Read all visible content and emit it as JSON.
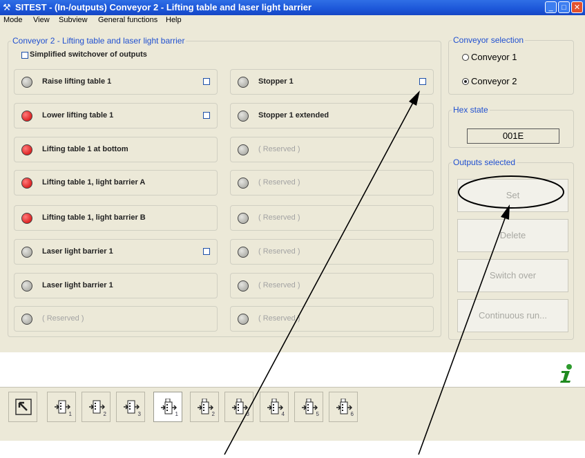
{
  "window": {
    "title": "SITEST - (In-/outputs) Conveyor 2 - Lifting table and laser light barrier",
    "minimize": "_",
    "maximize": "□",
    "close": "✕"
  },
  "menu": [
    "Mode",
    "View",
    "Subview",
    "General functions",
    "Help"
  ],
  "io_panel": {
    "legend": "Conveyor 2 - Lifting table and laser light barrier",
    "simplified_switchover": "Simplified switchover of outputs",
    "left": [
      {
        "label": "Raise lifting table 1",
        "led": "off",
        "checkbox": true
      },
      {
        "label": "Lower lifting table 1",
        "led": "on",
        "checkbox": true
      },
      {
        "label": "Lifting table 1 at bottom",
        "led": "on",
        "checkbox": false
      },
      {
        "label": "Lifting table 1, light barrier A",
        "led": "on",
        "checkbox": false
      },
      {
        "label": "Lifting table 1, light barrier B",
        "led": "on",
        "checkbox": false
      },
      {
        "label": "Laser light barrier 1",
        "led": "off",
        "checkbox": true
      },
      {
        "label": "Laser light barrier 1",
        "led": "off",
        "checkbox": false
      },
      {
        "label": "( Reserved )",
        "led": "off",
        "checkbox": false,
        "reserved": true
      }
    ],
    "right": [
      {
        "label": "Stopper 1",
        "led": "off",
        "checkbox": true
      },
      {
        "label": "Stopper 1 extended",
        "led": "off",
        "checkbox": false
      },
      {
        "label": "( Reserved )",
        "led": "off",
        "checkbox": false,
        "reserved": true
      },
      {
        "label": "( Reserved )",
        "led": "off",
        "checkbox": false,
        "reserved": true
      },
      {
        "label": "( Reserved )",
        "led": "off",
        "checkbox": false,
        "reserved": true
      },
      {
        "label": "( Reserved )",
        "led": "off",
        "checkbox": false,
        "reserved": true
      },
      {
        "label": "( Reserved )",
        "led": "off",
        "checkbox": false,
        "reserved": true
      },
      {
        "label": "( Reserved )",
        "led": "off",
        "checkbox": false,
        "reserved": true
      }
    ]
  },
  "conveyor_selection": {
    "legend": "Conveyor selection",
    "options": [
      "Conveyor 1",
      "Conveyor 2"
    ],
    "selected": "Conveyor 2"
  },
  "hex_state": {
    "legend": "Hex state",
    "value": "001E"
  },
  "outputs_selected": {
    "legend": "Outputs selected",
    "buttons": [
      "Set",
      "Delete",
      "Switch over",
      "Continuous run..."
    ]
  },
  "info_icon": "info-icon",
  "toolbar": {
    "buttons": [
      {
        "icon": "pointer-arrow-icon",
        "number": ""
      },
      {
        "icon": "station-icon",
        "number": "1"
      },
      {
        "icon": "station-icon",
        "number": "2"
      },
      {
        "icon": "station-icon",
        "number": "3"
      },
      {
        "icon": "conveyor-icon",
        "number": "1",
        "active": true
      },
      {
        "icon": "conveyor-icon",
        "number": "2"
      },
      {
        "icon": "conveyor-icon",
        "number": "3"
      },
      {
        "icon": "conveyor-icon",
        "number": "4"
      },
      {
        "icon": "conveyor-icon",
        "number": "5"
      },
      {
        "icon": "conveyor-icon",
        "number": "6"
      }
    ]
  },
  "colors": {
    "titlebar": "#1c56d8",
    "window_bg": "#ece9d8",
    "legend_text": "#1f4fd0",
    "led_on": "#d00000",
    "led_off": "#9d9d96",
    "annotation_ink": "#000000"
  }
}
